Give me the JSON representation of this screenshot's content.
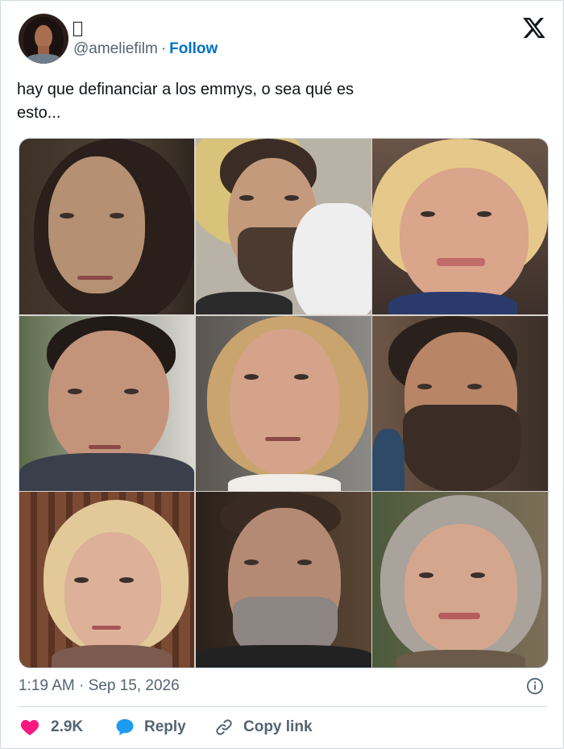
{
  "author": {
    "display_name_glyph": "",
    "handle": "@ameliefilm",
    "separator": "·",
    "follow_label": "Follow"
  },
  "tweet": {
    "text_line1": "hay que definanciar a los emmys, o sea qué es",
    "text_line2": "esto..."
  },
  "meta": {
    "time": "1:19 AM",
    "separator": "·",
    "date": "Sep 15, 2026"
  },
  "actions": {
    "likes": "2.9K",
    "reply_label": "Reply",
    "copy_link_label": "Copy link"
  },
  "colors": {
    "link_blue": "#0072c7",
    "heart_red": "#f91880",
    "muted": "#536471",
    "reply_blue": "#1d9bf0"
  },
  "icons": [
    "x-logo-icon",
    "info-icon",
    "heart-icon",
    "reply-bubble-icon",
    "link-icon"
  ]
}
